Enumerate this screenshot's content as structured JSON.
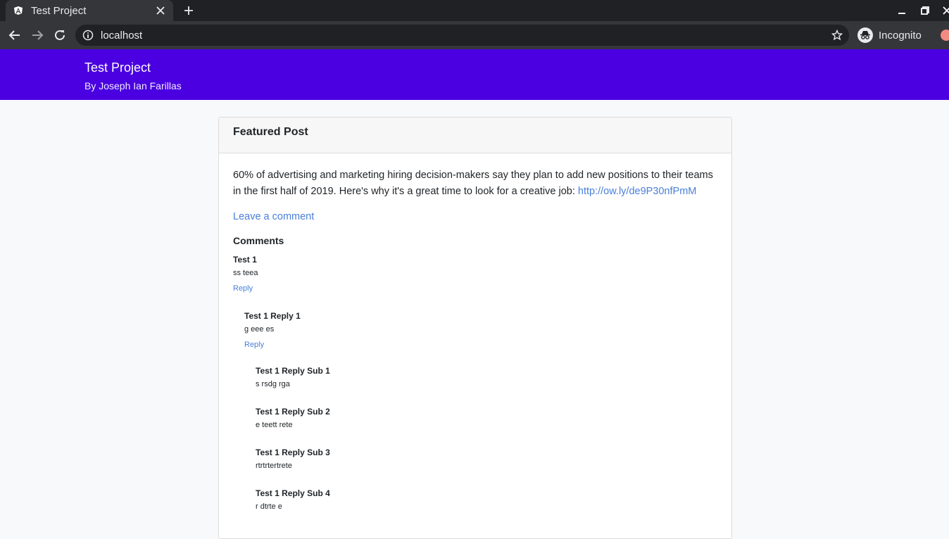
{
  "browser": {
    "tab_title": "Test Project",
    "url": "localhost",
    "profile_label": "Incognito"
  },
  "header": {
    "title": "Test Project",
    "subtitle": "By Joseph Ian Farillas"
  },
  "post": {
    "heading": "Featured Post",
    "text_before_link": "60% of advertising and marketing hiring decision-makers say they plan to add new positions to their teams in the first half of 2019. Here's why it's a great time to look for a creative job: ",
    "link_text": "http://ow.ly/de9P30nfPmM",
    "leave_comment": "Leave a comment"
  },
  "comments": {
    "heading": "Comments",
    "items": [
      {
        "author": "Test 1",
        "text": "ss teea",
        "reply": "Reply"
      },
      {
        "author": "Test 1 Reply 1",
        "text": "g eee es",
        "reply": "Reply"
      },
      {
        "author": "Test 1 Reply Sub 1",
        "text": "s rsdg rga"
      },
      {
        "author": "Test 1 Reply Sub 2",
        "text": "e teett rete"
      },
      {
        "author": "Test 1 Reply Sub 3",
        "text": "rtrtrtertrete"
      },
      {
        "author": "Test 1 Reply Sub 4",
        "text": "r dtrte e"
      }
    ]
  },
  "colors": {
    "header_bg": "#4a00e0",
    "link": "#4a7fd8"
  }
}
